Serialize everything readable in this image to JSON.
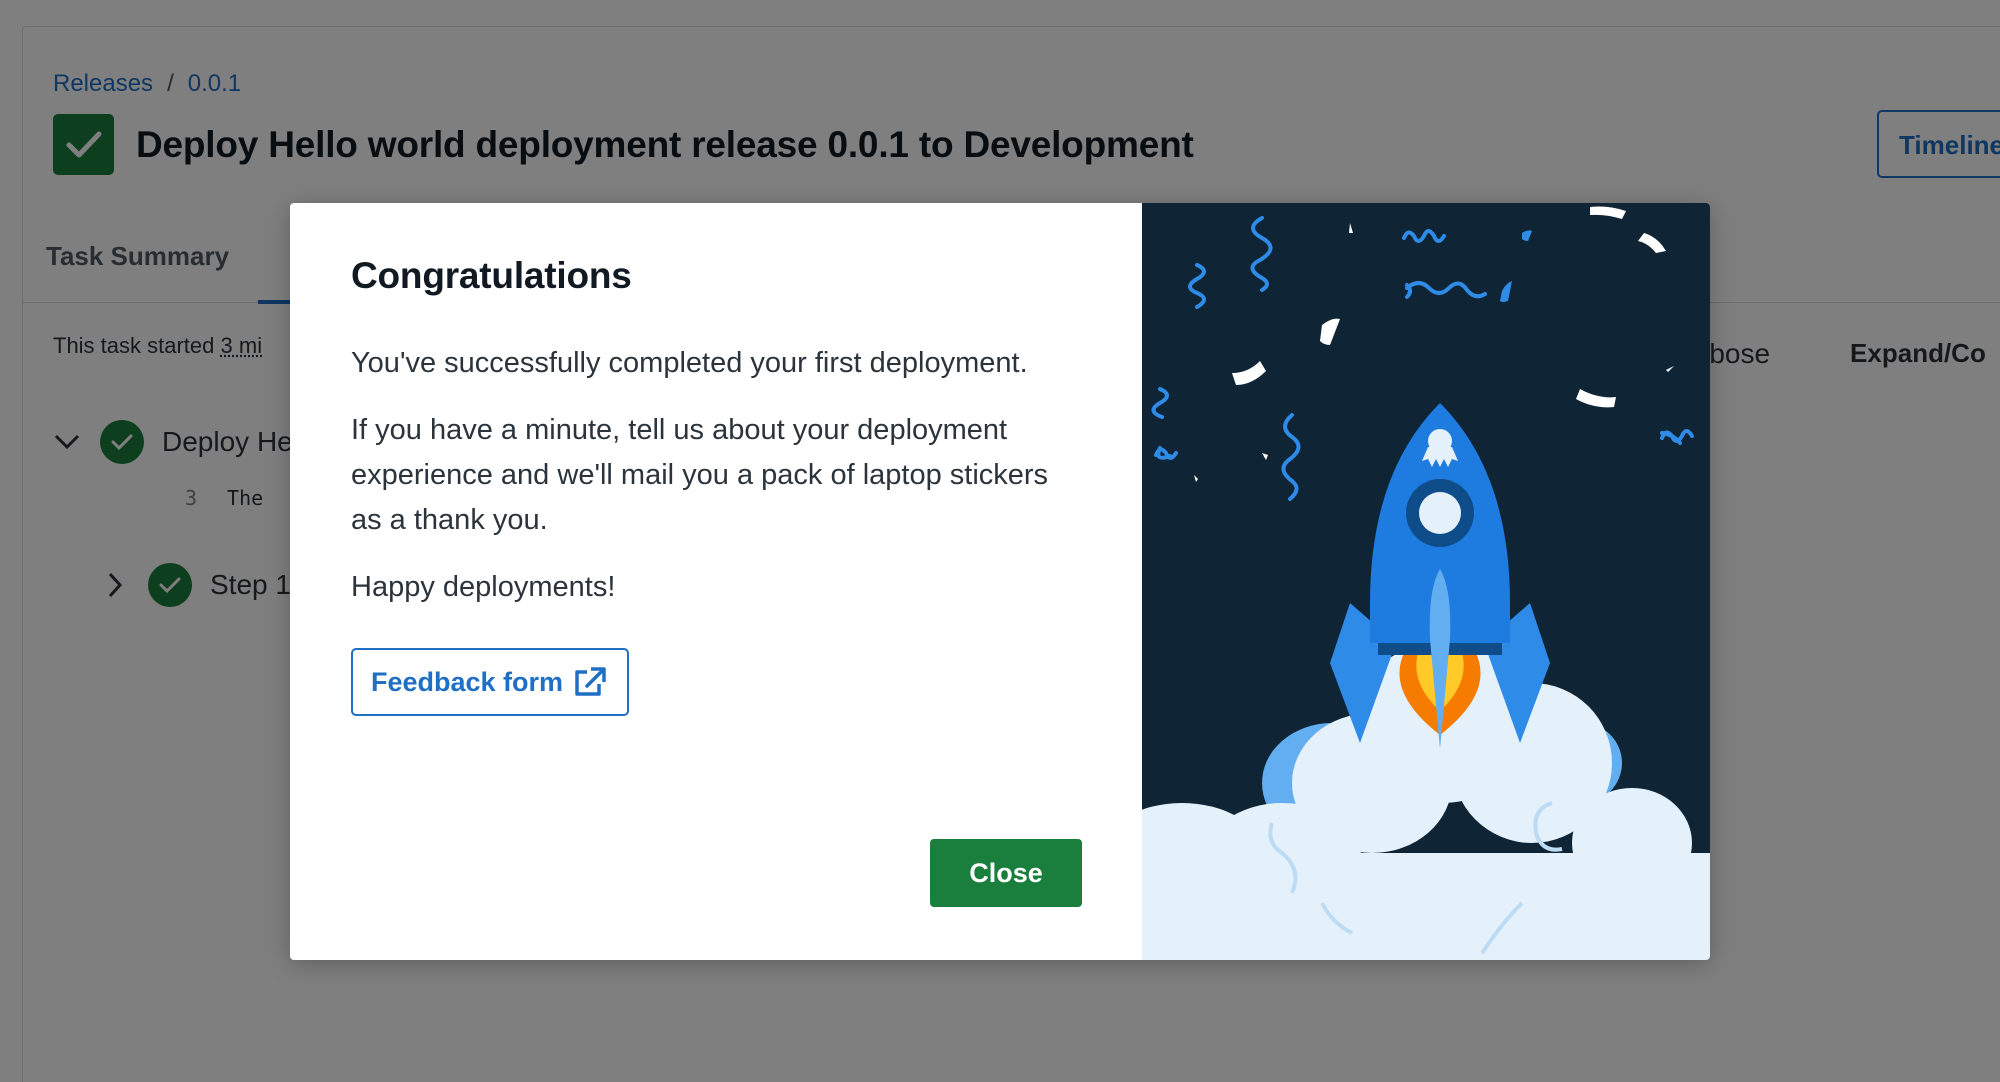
{
  "breadcrumb": {
    "items": [
      "Releases",
      "0.0.1"
    ],
    "separator": "/"
  },
  "header": {
    "title": "Deploy Hello world deployment release 0.0.1 to Development",
    "timeline_label": "Timeline"
  },
  "tabs": [
    {
      "label": "Task Summary"
    }
  ],
  "task": {
    "started_prefix": "This task started",
    "started_value": "3 mi"
  },
  "log_controls": {
    "verbose_label": "rbose",
    "expand_label": "Expand/Co"
  },
  "tree": {
    "deploy_label": "Deploy He",
    "log_line_number": "3",
    "log_line_text": "The",
    "step_label": "Step 1:"
  },
  "modal": {
    "title": "Congratulations",
    "paragraphs": [
      "You've successfully completed your first deployment.",
      "If you have a minute, tell us about your deployment experience and we'll mail you a pack of laptop stickers as a thank you.",
      "Happy deployments!"
    ],
    "feedback_label": "Feedback form",
    "close_label": "Close"
  },
  "colors": {
    "accent_blue": "#1f6fc5",
    "success_green": "#1a7f3c",
    "illustration_bg": "#0f2535",
    "rocket_blue": "#1e7be0",
    "cloud_light": "#e4f1fb"
  },
  "icons": {
    "status": "check-icon",
    "feedback": "external-link-icon",
    "collapse": "chevron-down-icon",
    "expand": "chevron-right-icon"
  }
}
